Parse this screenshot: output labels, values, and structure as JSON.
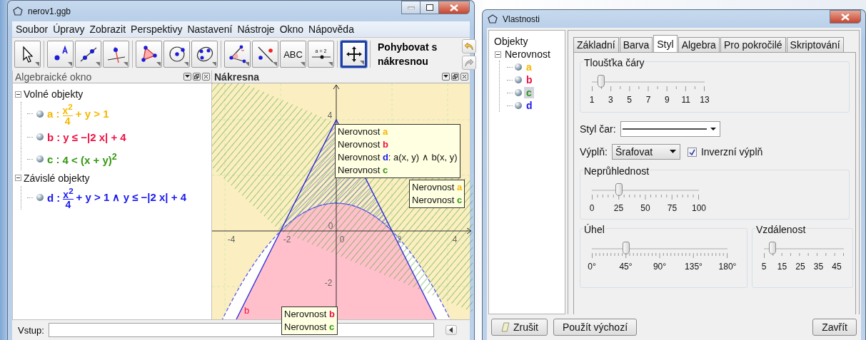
{
  "main_window": {
    "title": "nerov1.ggb",
    "menu": [
      "Soubor",
      "Úpravy",
      "Zobrazit",
      "Perspektivy",
      "Nastavení",
      "Nástroje",
      "Okno",
      "Nápověda"
    ],
    "tool_groups": [
      [
        {
          "kind": "pointer",
          "selected": false
        }
      ],
      [
        {
          "kind": "point",
          "selected": false
        },
        {
          "kind": "line",
          "selected": false
        },
        {
          "kind": "perpendicular",
          "selected": false
        }
      ],
      [
        {
          "kind": "polygon",
          "selected": false
        },
        {
          "kind": "circle",
          "selected": false
        },
        {
          "kind": "conic",
          "selected": false
        }
      ],
      [
        {
          "kind": "angle",
          "selected": false
        },
        {
          "kind": "reflect",
          "selected": false
        },
        {
          "kind": "text",
          "label": "ABC",
          "selected": false
        },
        {
          "kind": "slider",
          "label": "a = 2",
          "selected": false
        }
      ],
      [
        {
          "kind": "move",
          "selected": true
        }
      ]
    ],
    "tool_name": "Pohybovat s nákresnou",
    "algebra": {
      "title": "Algebraické okno",
      "groups": [
        {
          "label": "Volné objekty",
          "expanded": true,
          "objects": [
            {
              "label": "a :",
              "color": "#f5b800",
              "visible": true,
              "formula": [
                {
                  "kind": "frac",
                  "num": "x$^{2}$",
                  "den": "4"
                },
                {
                  "kind": "text",
                  "text": "+ y > 1"
                }
              ]
            },
            {
              "label": "b :",
              "color": "#ee1144",
              "visible": true,
              "formula": [
                {
                  "kind": "text",
                  "text": "y ≤ −|2 x| + 4"
                }
              ]
            },
            {
              "label": "c :",
              "color": "#339911",
              "visible": true,
              "formula": [
                {
                  "kind": "text",
                  "text": "4 < (x + y)$^{2}$"
                }
              ]
            }
          ]
        },
        {
          "label": "Závislé objekty",
          "expanded": true,
          "objects": [
            {
              "label": "d :",
              "color": "#1a1aee",
              "visible": true,
              "formula": [
                {
                  "kind": "frac",
                  "num": "x$^{2}$",
                  "den": "4"
                },
                {
                  "kind": "text",
                  "text": "+ y > 1 ∧ y ≤ −|2 x| + 4"
                }
              ]
            }
          ]
        }
      ]
    },
    "graphics": {
      "title": "Nákresna",
      "x_ticks": [
        "-4",
        "-2",
        "0",
        "2",
        "4"
      ],
      "y_ticks": [
        "4",
        "0",
        "-2"
      ],
      "curve_label": {
        "text": "b",
        "color": "#ee1144"
      },
      "tooltips": [
        {
          "lines": [
            {
              "text": "Nerovnost",
              "object": "a",
              "color": "#f5b800"
            },
            {
              "text": "Nerovnost",
              "object": "b",
              "color": "#ee1144"
            },
            {
              "text": "Nerovnost",
              "object": "d",
              "color": "#1a1aee",
              "rest": ": a(x, y) ∧ b(x, y)"
            },
            {
              "text": "Nerovnost",
              "object": "c",
              "color": "#339911"
            }
          ]
        },
        {
          "lines": [
            {
              "text": "Nerovnost",
              "object": "a",
              "color": "#f5b800"
            },
            {
              "text": "Nerovnost",
              "object": "c",
              "color": "#339911"
            }
          ]
        },
        {
          "lines": [
            {
              "text": "Nerovnost",
              "object": "b",
              "color": "#ee1144"
            },
            {
              "text": "Nerovnost",
              "object": "c",
              "color": "#339911"
            }
          ]
        }
      ]
    },
    "input": {
      "label": "Vstup:"
    }
  },
  "properties_window": {
    "title": "Vlastnosti",
    "tree": {
      "label": "Objekty",
      "children": [
        {
          "label": "Nerovnost",
          "expanded": true,
          "children": [
            {
              "label": "a",
              "color": "#f5b800",
              "selected": false
            },
            {
              "label": "b",
              "color": "#ee1144",
              "selected": false
            },
            {
              "label": "c",
              "color": "#339911",
              "selected": true
            },
            {
              "label": "d",
              "color": "#1a1aee",
              "selected": false
            }
          ]
        }
      ]
    },
    "tabs": [
      {
        "label": "Základní",
        "selected": false
      },
      {
        "label": "Barva",
        "selected": false
      },
      {
        "label": "Styl",
        "selected": true
      },
      {
        "label": "Algebra",
        "selected": false
      },
      {
        "label": "Pro pokročilé",
        "selected": false
      },
      {
        "label": "Skriptování",
        "selected": false
      }
    ],
    "line_thickness": {
      "title": "Tloušťka čáry",
      "level": 0.083,
      "labels": [
        "1",
        "3",
        "5",
        "7",
        "9",
        "11",
        "13"
      ]
    },
    "line_style": {
      "label": "Styl čar:"
    },
    "fill": {
      "label": "Výplň:",
      "value": "Šrafovat",
      "inverse": {
        "label": "Inverzní výplň",
        "checked": true
      }
    },
    "opacity": {
      "title": "Neprůhlednost",
      "level": 0.25,
      "labels": [
        "0",
        "25",
        "50",
        "75",
        "100"
      ]
    },
    "angle": {
      "title": "Úhel",
      "level": 0.25,
      "labels": [
        "0°",
        "45°",
        "90°",
        "135°",
        "180°"
      ]
    },
    "distance": {
      "title": "Vzdálenost",
      "level": 0.11,
      "labels": [
        "5",
        "15",
        "25",
        "35",
        "45"
      ]
    },
    "buttons": [
      {
        "kind": "cancel",
        "label": "Zrušit"
      },
      {
        "kind": "default",
        "label": "Použít výchozí"
      },
      {
        "kind": "close",
        "label": "Zavřít"
      }
    ]
  }
}
